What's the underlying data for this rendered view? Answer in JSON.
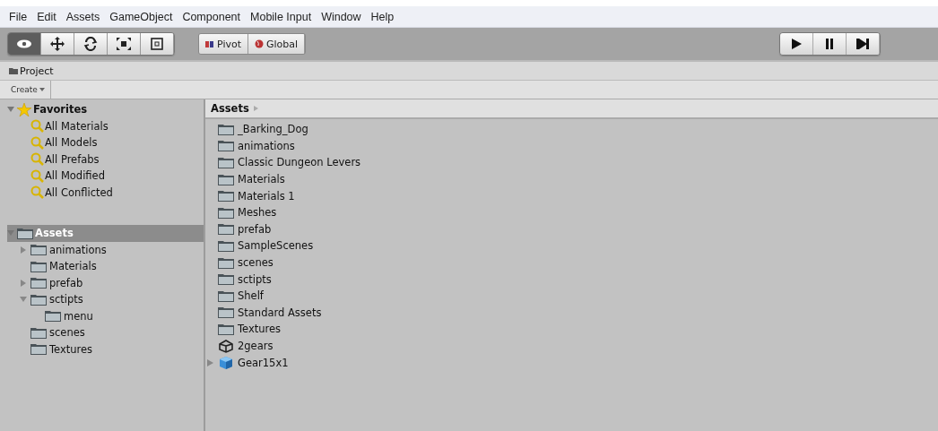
{
  "menu": [
    "File",
    "Edit",
    "Assets",
    "GameObject",
    "Component",
    "Mobile Input",
    "Window",
    "Help"
  ],
  "tools": [
    {
      "kind": "view",
      "selected": true
    },
    {
      "kind": "move",
      "selected": false
    },
    {
      "kind": "rotate",
      "selected": false
    },
    {
      "kind": "scale",
      "selected": false
    },
    {
      "kind": "rect",
      "selected": false
    }
  ],
  "pivot_buttons": [
    {
      "kind": "pivot",
      "label": "Pivot"
    },
    {
      "kind": "global",
      "label": "Global"
    }
  ],
  "playback": [
    {
      "kind": "play",
      "selected": false
    },
    {
      "kind": "pause",
      "selected": false
    },
    {
      "kind": "step",
      "selected": false
    }
  ],
  "panel_tab": "Project",
  "create_button": "Create",
  "favorites": {
    "label": "Favorites",
    "expanded": true,
    "items": [
      "All Materials",
      "All Models",
      "All Prefabs",
      "All Modified",
      "All Conflicted"
    ]
  },
  "tree": {
    "label": "Assets",
    "selected": true,
    "expanded": true,
    "children": [
      {
        "label": "animations",
        "expanded": false
      },
      {
        "label": "Materials"
      },
      {
        "label": "prefab",
        "expanded": false
      },
      {
        "label": "sctipts",
        "expanded": true,
        "children": [
          {
            "label": "menu"
          }
        ]
      },
      {
        "label": "scenes"
      },
      {
        "label": "Textures"
      }
    ]
  },
  "breadcrumb": "Assets",
  "files": [
    {
      "label": "_Barking_Dog",
      "kind": "folder"
    },
    {
      "label": "animations",
      "kind": "folder"
    },
    {
      "label": "Classic Dungeon Levers",
      "kind": "folder"
    },
    {
      "label": "Materials",
      "kind": "folder"
    },
    {
      "label": "Materials 1",
      "kind": "folder"
    },
    {
      "label": "Meshes",
      "kind": "folder"
    },
    {
      "label": "prefab",
      "kind": "folder"
    },
    {
      "label": "SampleScenes",
      "kind": "folder"
    },
    {
      "label": "scenes",
      "kind": "folder"
    },
    {
      "label": "sctipts",
      "kind": "folder"
    },
    {
      "label": "Shelf",
      "kind": "folder"
    },
    {
      "label": "Standard Assets",
      "kind": "folder"
    },
    {
      "label": "Textures",
      "kind": "folder"
    },
    {
      "label": "2gears",
      "kind": "scene"
    },
    {
      "label": "Gear15x1",
      "kind": "prefab",
      "expanded": false
    }
  ]
}
